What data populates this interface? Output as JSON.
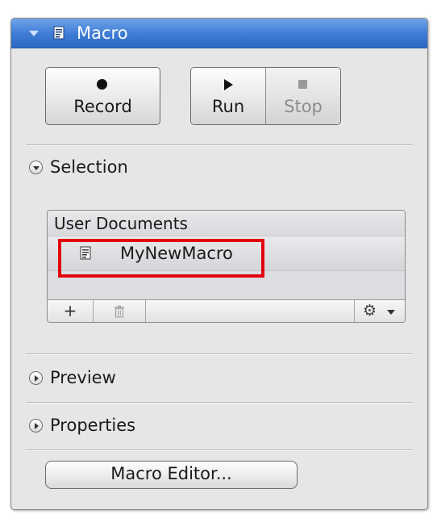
{
  "panel": {
    "title": "Macro",
    "title_icon": "macro-document-icon",
    "collapse_icon": "chevron-down-icon"
  },
  "controls": {
    "record_label": "Record",
    "run_label": "Run",
    "stop_label": "Stop",
    "record_icon": "record-dot-icon",
    "run_icon": "play-icon",
    "stop_icon": "stop-square-icon"
  },
  "sections": {
    "selection_label": "Selection",
    "preview_label": "Preview",
    "properties_label": "Properties"
  },
  "list": {
    "group_header": "User Documents",
    "items": [
      {
        "label": "MyNewMacro",
        "icon": "macro-document-icon",
        "highlighted": true
      }
    ],
    "toolbar": {
      "add_icon": "plus-icon",
      "add_label": "+",
      "delete_icon": "trash-icon",
      "options_icon": "gear-icon"
    }
  },
  "editor": {
    "button_label": "Macro Editor..."
  },
  "colors": {
    "header_blue": "#3d7bd5",
    "panel_bg": "#e6e6e6",
    "highlight_red": "#e3000f",
    "disabled_text": "#8d8d8d"
  }
}
